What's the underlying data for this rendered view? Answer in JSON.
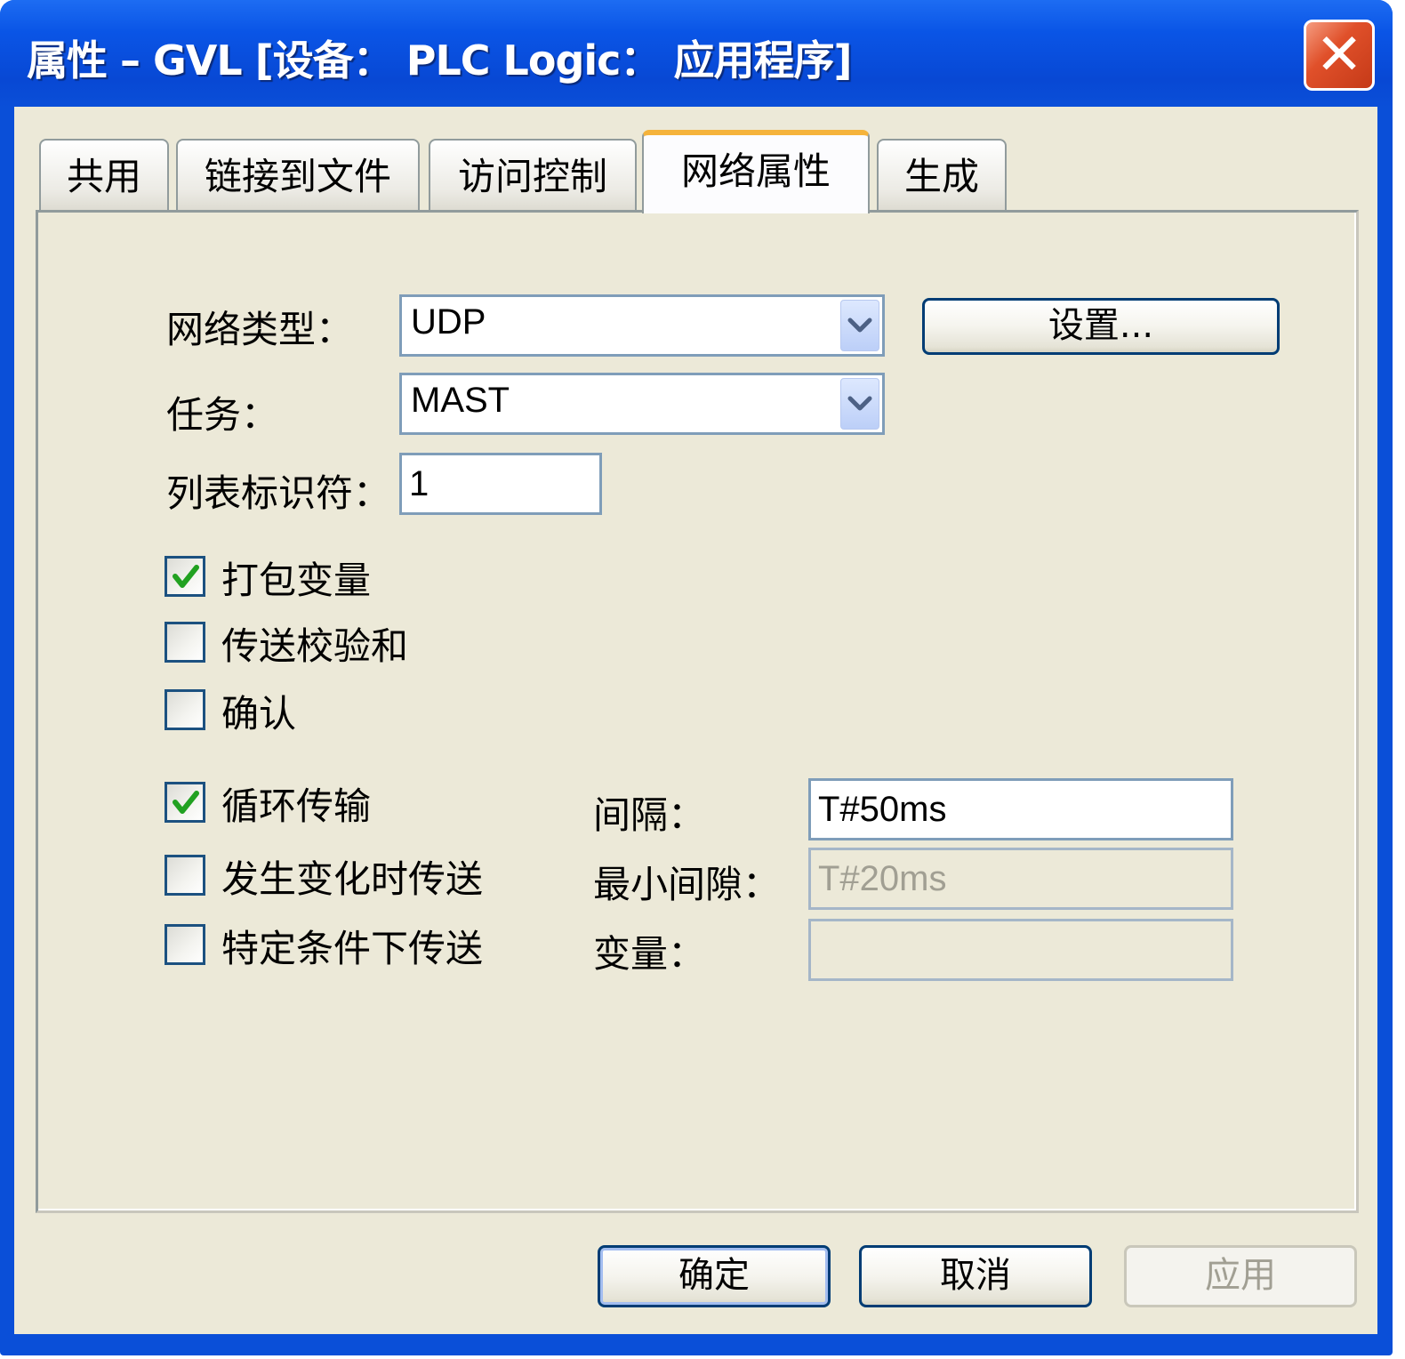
{
  "window": {
    "title": "属性 – GVL [设备： PLC Logic： 应用程序]",
    "close_glyph": "✕"
  },
  "tabs": [
    {
      "label": "共用",
      "active": false
    },
    {
      "label": "链接到文件",
      "active": false
    },
    {
      "label": "访问控制",
      "active": false
    },
    {
      "label": "网络属性",
      "active": true
    },
    {
      "label": "生成",
      "active": false
    }
  ],
  "form": {
    "network_type": {
      "label": "网络类型：",
      "value": "UDP",
      "settings_button": "设置..."
    },
    "task": {
      "label": "任务：",
      "value": "MAST"
    },
    "list_id": {
      "label": "列表标识符：",
      "value": "1"
    }
  },
  "options": [
    {
      "label": "打包变量",
      "checked": true
    },
    {
      "label": "传送校验和",
      "checked": false
    },
    {
      "label": "确认",
      "checked": false
    }
  ],
  "transmission": [
    {
      "label": "循环传输",
      "checked": true
    },
    {
      "label": "发生变化时传送",
      "checked": false
    },
    {
      "label": "特定条件下传送",
      "checked": false
    }
  ],
  "fields": {
    "interval": {
      "label": "间隔：",
      "value": "T#50ms",
      "enabled": true
    },
    "min_gap": {
      "label": "最小间隙：",
      "value": "T#20ms",
      "enabled": false
    },
    "variable": {
      "label": "变量：",
      "value": "",
      "enabled": false
    }
  },
  "buttons": {
    "ok": "确定",
    "cancel": "取消",
    "apply": "应用"
  },
  "colors": {
    "titlebar": "#0a4fd8",
    "dialog_bg": "#ece9d8",
    "check_green": "#21a121",
    "active_tab_accent": "#f5b33b"
  }
}
